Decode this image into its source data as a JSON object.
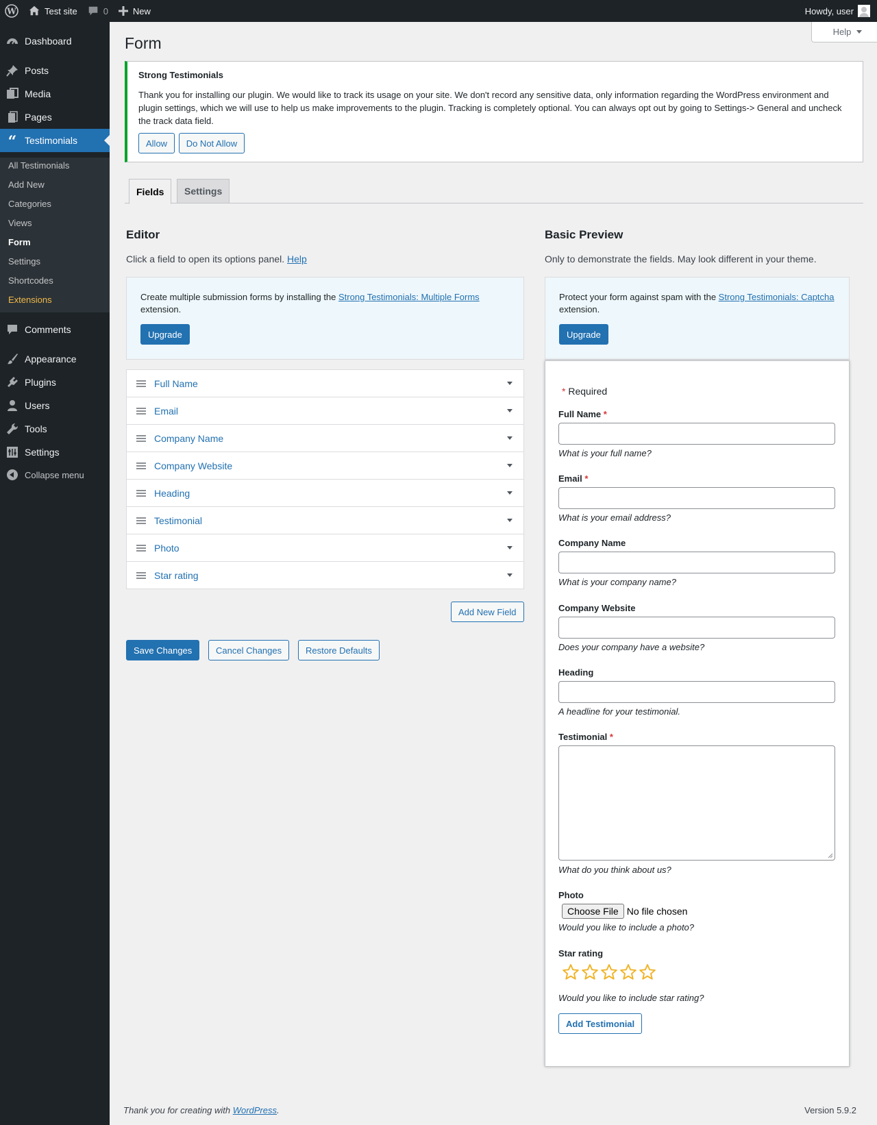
{
  "admin_bar": {
    "site_name": "Test site",
    "comments_count": "0",
    "new_label": "New",
    "greeting": "Howdy, user"
  },
  "sidebar": {
    "menu": [
      {
        "label": "Dashboard",
        "icon": "dashboard-icon"
      },
      {
        "label": "Posts",
        "icon": "pin-icon"
      },
      {
        "label": "Media",
        "icon": "media-icon"
      },
      {
        "label": "Pages",
        "icon": "pages-icon"
      },
      {
        "label": "Testimonials",
        "icon": "quote-icon"
      },
      {
        "label": "Comments",
        "icon": "comment-icon"
      },
      {
        "label": "Appearance",
        "icon": "brush-icon"
      },
      {
        "label": "Plugins",
        "icon": "plugin-icon"
      },
      {
        "label": "Users",
        "icon": "user-icon"
      },
      {
        "label": "Tools",
        "icon": "wrench-icon"
      },
      {
        "label": "Settings",
        "icon": "settings-icon"
      }
    ],
    "submenu": [
      "All Testimonials",
      "Add New",
      "Categories",
      "Views",
      "Form",
      "Settings",
      "Shortcodes",
      "Extensions"
    ],
    "collapse_label": "Collapse menu"
  },
  "help_tab": "Help",
  "page_title": "Form",
  "notice": {
    "title": "Strong Testimonials",
    "text": "Thank you for installing our plugin. We would like to track its usage on your site. We don't record any sensitive data, only information regarding the WordPress environment and plugin settings, which we will use to help us make improvements to the plugin. Tracking is completely optional. You can always opt out by going to Settings-> General and uncheck the track data field.",
    "allow": "Allow",
    "deny": "Do Not Allow"
  },
  "tabs": [
    "Fields",
    "Settings"
  ],
  "editor": {
    "title": "Editor",
    "desc": "Click a field to open its options panel.",
    "help_link": "Help",
    "promo_pre": "Create multiple submission forms by installing the ",
    "promo_link": "Strong Testimonials: Multiple Forms",
    "promo_post": "extension.",
    "upgrade": "Upgrade",
    "fields": [
      "Full Name",
      "Email",
      "Company Name",
      "Company Website",
      "Heading",
      "Testimonial",
      "Photo",
      "Star rating"
    ],
    "add_field": "Add New Field",
    "save": "Save Changes",
    "cancel": "Cancel Changes",
    "restore": "Restore Defaults"
  },
  "preview": {
    "title": "Basic Preview",
    "desc": "Only to demonstrate the fields. May look different in your theme.",
    "promo_pre": "Protect your form against spam with the ",
    "promo_link": "Strong Testimonials: Captcha",
    "promo_post": "extension.",
    "upgrade": "Upgrade",
    "required_note": "Required",
    "fields": [
      {
        "label": "Full Name",
        "required": true,
        "hint": "What is your full name?"
      },
      {
        "label": "Email",
        "required": true,
        "hint": "What is your email address?"
      },
      {
        "label": "Company Name",
        "required": false,
        "hint": "What is your company name?"
      },
      {
        "label": "Company Website",
        "required": false,
        "hint": "Does your company have a website?"
      },
      {
        "label": "Heading",
        "required": false,
        "hint": "A headline for your testimonial."
      },
      {
        "label": "Testimonial",
        "required": true,
        "hint": "What do you think about us?"
      },
      {
        "label": "Photo",
        "required": false,
        "hint": "Would you like to include a photo?"
      },
      {
        "label": "Star rating",
        "required": false,
        "hint": "Would you like to include star rating?"
      }
    ],
    "choose_file": "Choose File",
    "no_file": "No file chosen",
    "star_count": 5,
    "star_value": 0,
    "submit": "Add Testimonial"
  },
  "footer": {
    "left_pre": "Thank you for creating with ",
    "left_link": "WordPress",
    "left_post": ".",
    "version": "Version 5.9.2"
  },
  "colors": {
    "accent": "#2271b1",
    "admin_dark": "#1d2327",
    "notice_success": "#00a32a",
    "star": "#f0b429",
    "required": "#d63638"
  }
}
